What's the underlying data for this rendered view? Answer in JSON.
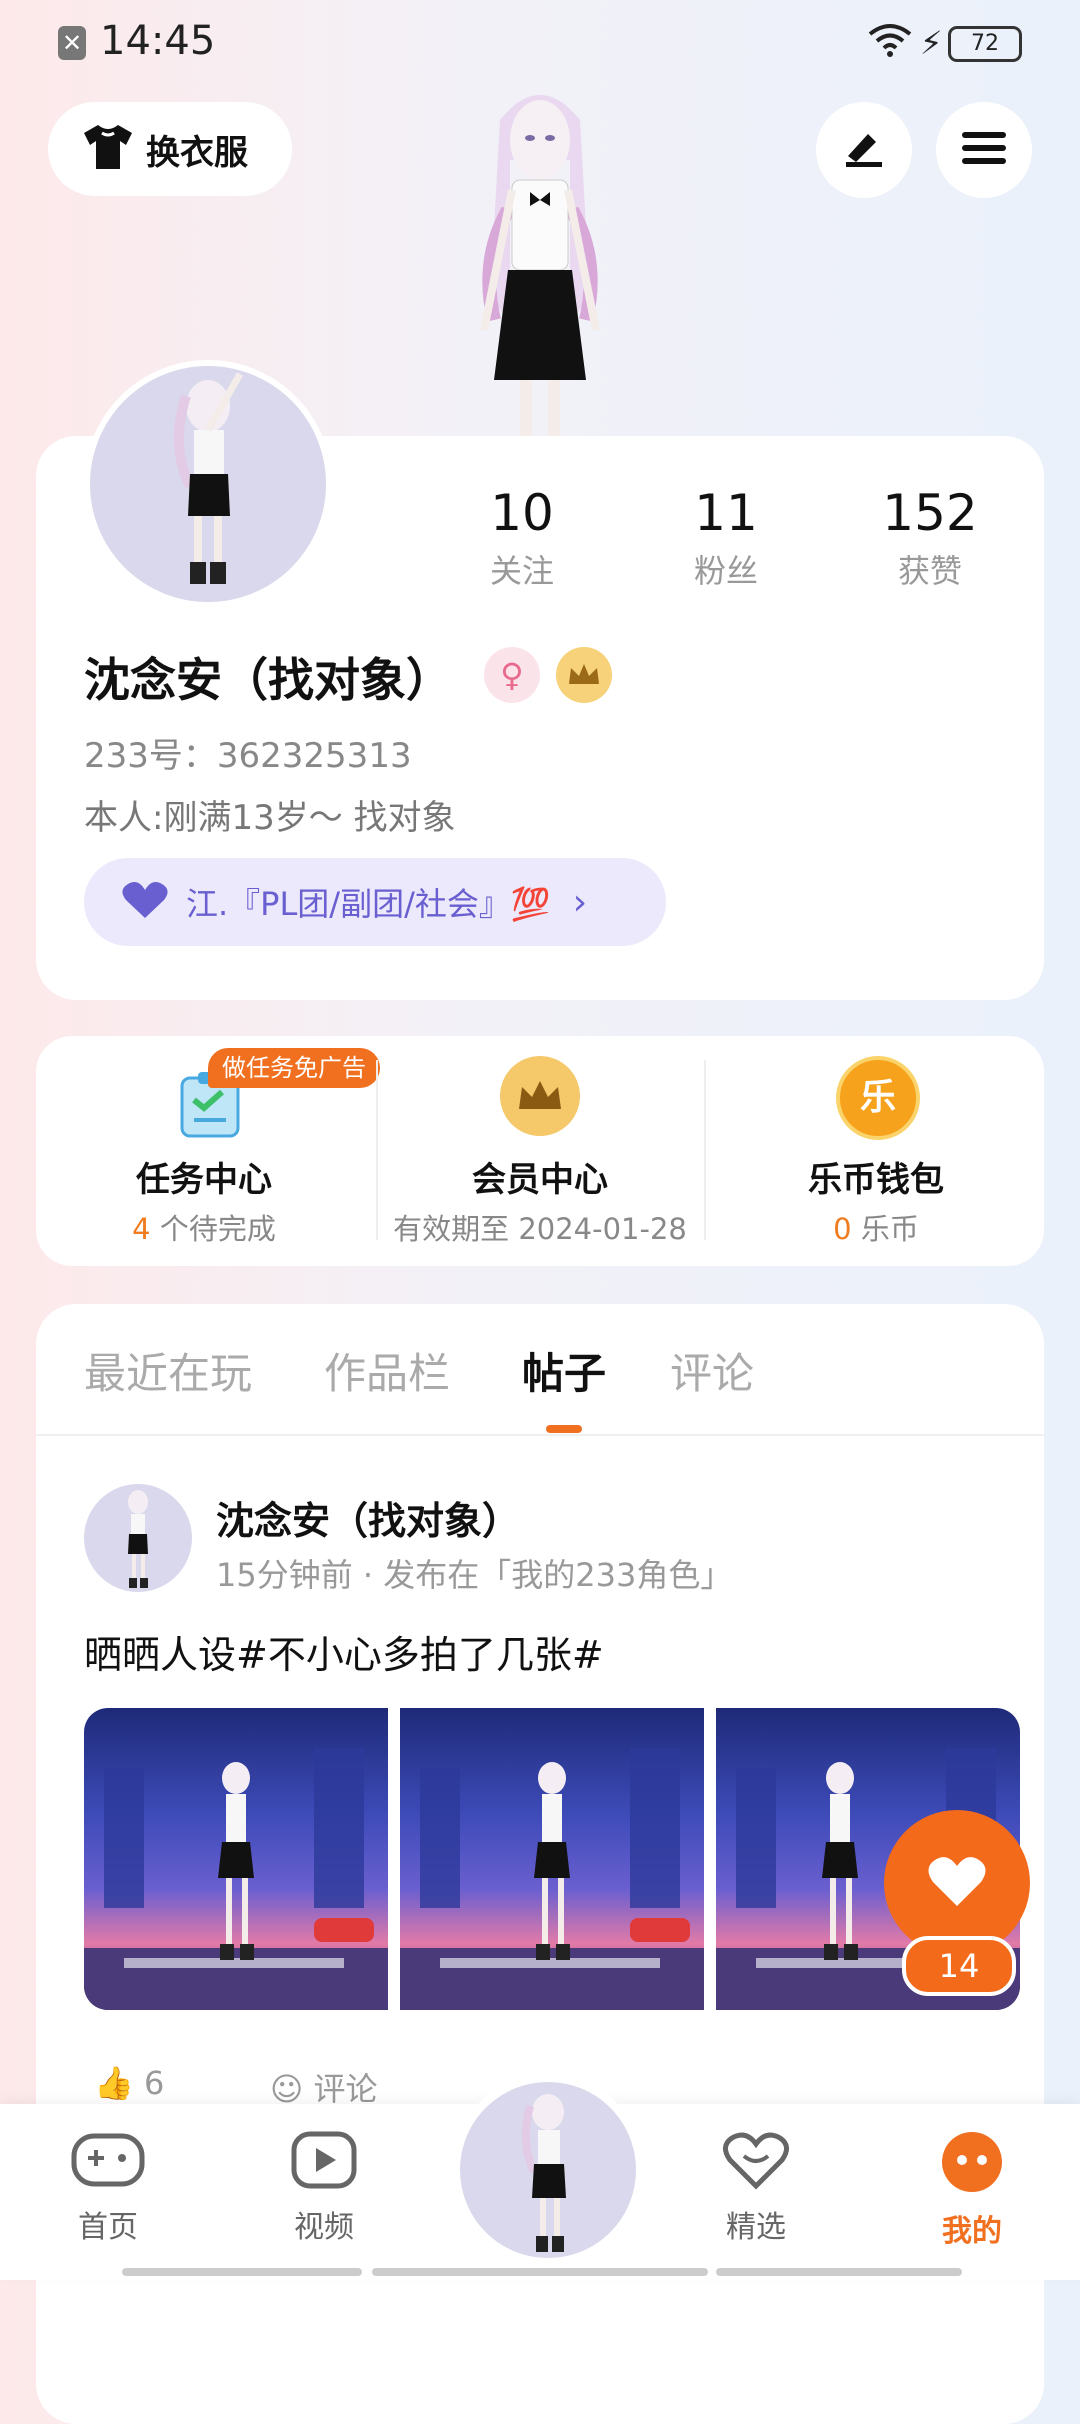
{
  "status_bar": {
    "time": "14:45",
    "battery": "72"
  },
  "top": {
    "outfit_label": "换衣服"
  },
  "profile": {
    "stats": [
      {
        "value": "10",
        "label": "关注"
      },
      {
        "value": "11",
        "label": "粉丝"
      },
      {
        "value": "152",
        "label": "获赞"
      }
    ],
    "name": "沈念安（找对象）",
    "uid": "233号：362325313",
    "bio": "本人:刚满13岁～    找对象",
    "group": "江.『PL团/副团/社会』💯"
  },
  "services": {
    "badge": "做任务免广告",
    "items": [
      {
        "title": "任务中心",
        "count": "4",
        "sub": " 个待完成"
      },
      {
        "title": "会员中心",
        "sub": "有效期至 2024-01-28"
      },
      {
        "title": "乐币钱包",
        "count": "0",
        "sub": " 乐币"
      }
    ]
  },
  "tabs": [
    "最近在玩",
    "作品栏",
    "帖子",
    "评论"
  ],
  "active_tab": "帖子",
  "post": {
    "author": "沈念安（找对象）",
    "meta": "15分钟前 · 发布在「我的233角色」",
    "text": "晒晒人设#不小心多拍了几张#",
    "like_count": "14",
    "thumbs_up": "6",
    "comment_label": "评论"
  },
  "nav": [
    {
      "label": "首页",
      "icon": "gamepad-icon"
    },
    {
      "label": "视频",
      "icon": "video-play-icon"
    },
    {
      "label": "精选",
      "icon": "heart-chat-icon"
    },
    {
      "label": "我的",
      "icon": "profile-face-icon"
    }
  ],
  "colors": {
    "accent": "#f07020",
    "purple": "#6a5fd0"
  }
}
